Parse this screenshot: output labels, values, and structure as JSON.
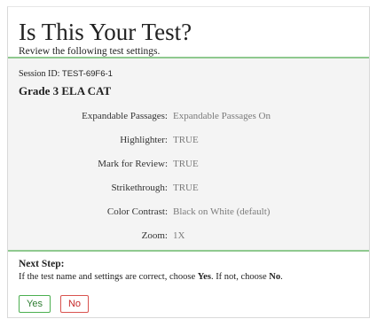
{
  "header": {
    "title": "Is This Your Test?",
    "subtitle": "Review the following test settings."
  },
  "session": {
    "label": "Session ID: ",
    "id": "TEST-69F6-1"
  },
  "test_name": "Grade 3 ELA CAT",
  "settings": [
    {
      "label": "Expandable Passages:",
      "value": "Expandable Passages On"
    },
    {
      "label": "Highlighter:",
      "value": "TRUE"
    },
    {
      "label": "Mark for Review:",
      "value": "TRUE"
    },
    {
      "label": "Strikethrough:",
      "value": "TRUE"
    },
    {
      "label": "Color Contrast:",
      "value": "Black on White (default)"
    },
    {
      "label": "Zoom:",
      "value": "1X"
    }
  ],
  "next_step": {
    "title": "Next Step:",
    "text_1": "If the test name and settings are correct, choose ",
    "bold_yes": "Yes",
    "text_2": ". If not, choose ",
    "bold_no": "No",
    "text_3": "."
  },
  "buttons": {
    "yes_label": "Yes",
    "no_label": "No"
  },
  "colors": {
    "divider": "#8fc98f",
    "yes": "#4caf50",
    "no": "#d9534f"
  }
}
